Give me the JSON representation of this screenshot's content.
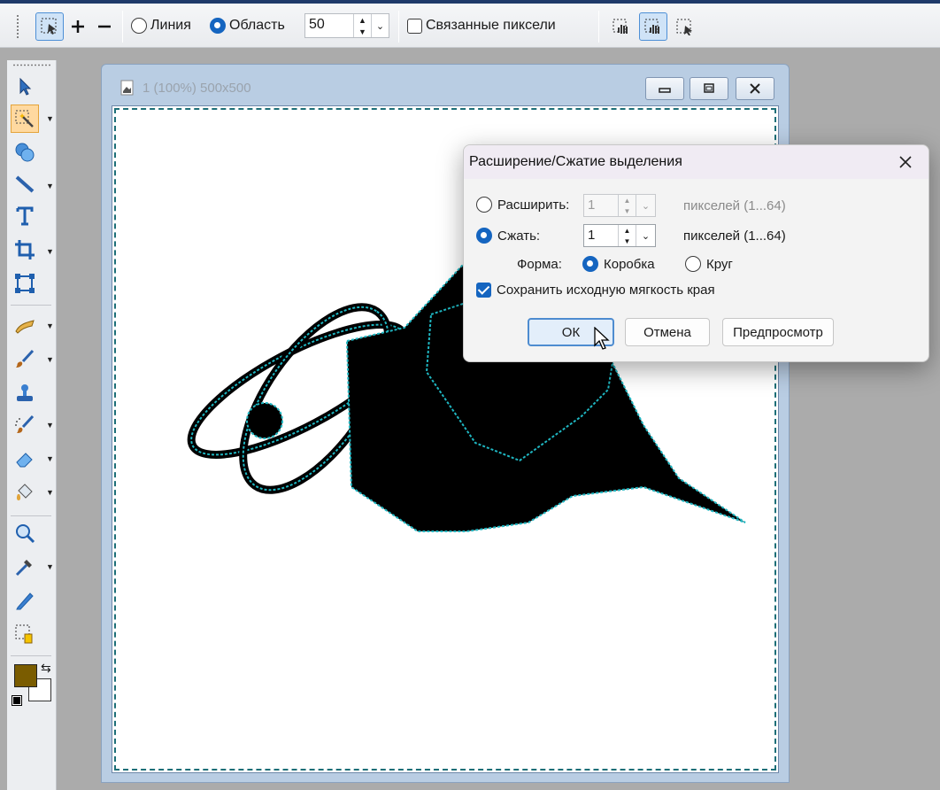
{
  "options_bar": {
    "mode_line_label": "Линия",
    "mode_area_label": "Область",
    "mode_selected": "area",
    "tolerance_value": "50",
    "linked_pixels_label": "Связанные пиксели",
    "linked_pixels_checked": false,
    "icons": [
      "selection-mode-icon",
      "add-icon",
      "subtract-icon",
      "select-similar-icon",
      "select-linked-icon",
      "select-rect-icon"
    ]
  },
  "toolbox": {
    "tools": [
      "pointer-icon",
      "magic-wand-icon",
      "shapes-icon",
      "line-icon",
      "text-icon",
      "crop-icon",
      "transform-icon",
      "smudge-icon",
      "brush-icon",
      "stamp-icon",
      "airbrush-icon",
      "eraser-icon",
      "fill-icon",
      "zoom-icon",
      "eyedropper-icon",
      "pen-icon",
      "selection-color-icon"
    ],
    "foreground_color": "#7a5c00",
    "background_color": "#ffffff"
  },
  "image_window": {
    "title": "1 (100%) 500x500"
  },
  "dialog": {
    "title": "Расширение/Сжатие выделения",
    "expand_label": "Расширить:",
    "expand_value": "1",
    "expand_range": "пикселей (1...64)",
    "shrink_label": "Сжать:",
    "shrink_value": "1",
    "shrink_range": "пикселей (1...64)",
    "shape_label": "Форма:",
    "shape_box_label": "Коробка",
    "shape_circle_label": "Круг",
    "keep_softness_label": "Сохранить исходную мягкость края",
    "keep_softness_checked": true,
    "ok_label": "ОК",
    "cancel_label": "Отмена",
    "preview_label": "Предпросмотр"
  },
  "colors": {
    "accent": "#1565c0",
    "selection_marquee": "#1fb7c2"
  }
}
